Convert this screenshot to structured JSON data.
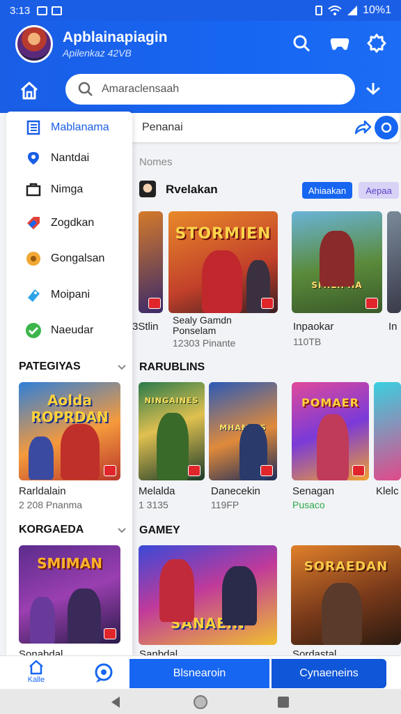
{
  "status": {
    "time": "3:13",
    "right": "10%1"
  },
  "header": {
    "title": "Apblainapiagin",
    "subtitle": "Apilenkaz 42VB",
    "search_placeholder": "Amaraclensaah"
  },
  "secondary_bar": {
    "label": "Penanai"
  },
  "drawer": {
    "items": [
      {
        "label": "Mablanama",
        "icon": "document-list-icon",
        "active": true
      },
      {
        "label": "Nantdai",
        "icon": "location-pin-icon"
      },
      {
        "label": "Nimga",
        "icon": "briefcase-icon"
      },
      {
        "label": "Zogdkan",
        "icon": "tag-icon"
      },
      {
        "label": "Gongalsan",
        "icon": "coin-icon"
      },
      {
        "label": "Moipani",
        "icon": "label-icon"
      },
      {
        "label": "Naeudar",
        "icon": "check-circle-icon"
      }
    ],
    "section1": {
      "title": "PATEGIYAS",
      "card_title": "Rarldalain",
      "card_meta": "2 208 Pnanma",
      "card_brand": "Aolda ROPRDAN"
    },
    "section2": {
      "title": "KORGAEDA",
      "card_title": "Sonabdal",
      "card_brand": "SMIMAN"
    }
  },
  "content": {
    "label": "Nomes",
    "developer": "Rvelakan",
    "chip_blue": "Ahiaakan",
    "chip_purple": "Aepaa",
    "row1": [
      {
        "title": "3Stlin",
        "brand": ""
      },
      {
        "title": "Sealy Gamdn Ponselam",
        "meta": "12303 Pinante",
        "brand": "STORMIEN"
      },
      {
        "title": "Inpaokar",
        "meta": "110TB",
        "brand": "SMILIPIIA"
      },
      {
        "title": "In",
        "brand": ""
      }
    ],
    "section_rankings": "RARUBLINS",
    "row2": [
      {
        "title": "Melalda",
        "meta": "1 3135",
        "brand": "NINGAINES"
      },
      {
        "title": "Danecekin",
        "meta": "119FP",
        "brand": "MHAMUIS"
      },
      {
        "title": "Senagan",
        "meta": "Pusaco",
        "brand": "POMAER"
      },
      {
        "title": "Klelc",
        "brand": ""
      }
    ],
    "section_games": "GAMEY",
    "row3": [
      {
        "title": "Sanbdal",
        "brand": "SANAEIN"
      },
      {
        "title": "Sordastal",
        "brand": "SORAEDAN"
      }
    ]
  },
  "bottom": {
    "home_label": "Kalle",
    "button_left": "Blsnearoin",
    "button_right": "Cynaeneins"
  },
  "colors": {
    "primary": "#1766f2",
    "header": "#1a5ee6",
    "accent_green": "#2ea84a"
  }
}
